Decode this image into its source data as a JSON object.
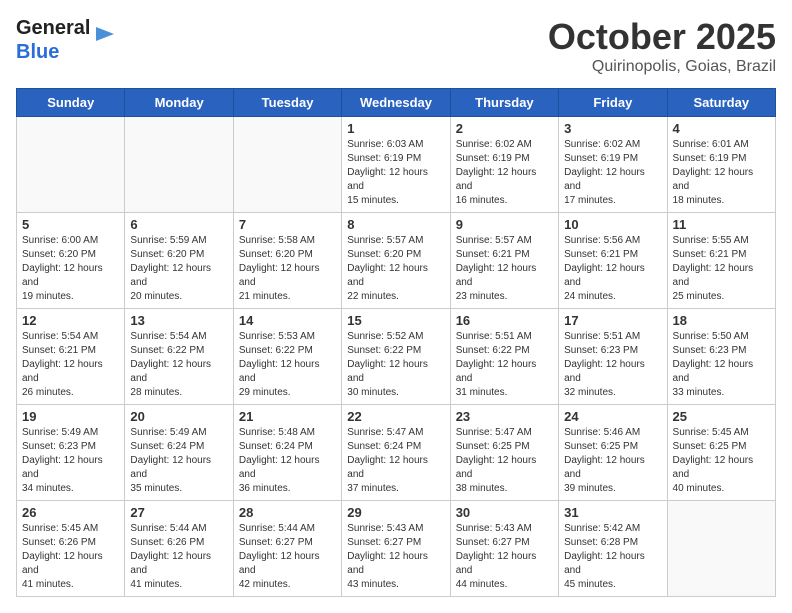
{
  "logo": {
    "line1": "General",
    "line2": "Blue"
  },
  "title": "October 2025",
  "subtitle": "Quirinopolis, Goias, Brazil",
  "weekdays": [
    "Sunday",
    "Monday",
    "Tuesday",
    "Wednesday",
    "Thursday",
    "Friday",
    "Saturday"
  ],
  "weeks": [
    [
      {
        "day": "",
        "info": ""
      },
      {
        "day": "",
        "info": ""
      },
      {
        "day": "",
        "info": ""
      },
      {
        "day": "1",
        "info": "Sunrise: 6:03 AM\nSunset: 6:19 PM\nDaylight: 12 hours and 15 minutes."
      },
      {
        "day": "2",
        "info": "Sunrise: 6:02 AM\nSunset: 6:19 PM\nDaylight: 12 hours and 16 minutes."
      },
      {
        "day": "3",
        "info": "Sunrise: 6:02 AM\nSunset: 6:19 PM\nDaylight: 12 hours and 17 minutes."
      },
      {
        "day": "4",
        "info": "Sunrise: 6:01 AM\nSunset: 6:19 PM\nDaylight: 12 hours and 18 minutes."
      }
    ],
    [
      {
        "day": "5",
        "info": "Sunrise: 6:00 AM\nSunset: 6:20 PM\nDaylight: 12 hours and 19 minutes."
      },
      {
        "day": "6",
        "info": "Sunrise: 5:59 AM\nSunset: 6:20 PM\nDaylight: 12 hours and 20 minutes."
      },
      {
        "day": "7",
        "info": "Sunrise: 5:58 AM\nSunset: 6:20 PM\nDaylight: 12 hours and 21 minutes."
      },
      {
        "day": "8",
        "info": "Sunrise: 5:57 AM\nSunset: 6:20 PM\nDaylight: 12 hours and 22 minutes."
      },
      {
        "day": "9",
        "info": "Sunrise: 5:57 AM\nSunset: 6:21 PM\nDaylight: 12 hours and 23 minutes."
      },
      {
        "day": "10",
        "info": "Sunrise: 5:56 AM\nSunset: 6:21 PM\nDaylight: 12 hours and 24 minutes."
      },
      {
        "day": "11",
        "info": "Sunrise: 5:55 AM\nSunset: 6:21 PM\nDaylight: 12 hours and 25 minutes."
      }
    ],
    [
      {
        "day": "12",
        "info": "Sunrise: 5:54 AM\nSunset: 6:21 PM\nDaylight: 12 hours and 26 minutes."
      },
      {
        "day": "13",
        "info": "Sunrise: 5:54 AM\nSunset: 6:22 PM\nDaylight: 12 hours and 28 minutes."
      },
      {
        "day": "14",
        "info": "Sunrise: 5:53 AM\nSunset: 6:22 PM\nDaylight: 12 hours and 29 minutes."
      },
      {
        "day": "15",
        "info": "Sunrise: 5:52 AM\nSunset: 6:22 PM\nDaylight: 12 hours and 30 minutes."
      },
      {
        "day": "16",
        "info": "Sunrise: 5:51 AM\nSunset: 6:22 PM\nDaylight: 12 hours and 31 minutes."
      },
      {
        "day": "17",
        "info": "Sunrise: 5:51 AM\nSunset: 6:23 PM\nDaylight: 12 hours and 32 minutes."
      },
      {
        "day": "18",
        "info": "Sunrise: 5:50 AM\nSunset: 6:23 PM\nDaylight: 12 hours and 33 minutes."
      }
    ],
    [
      {
        "day": "19",
        "info": "Sunrise: 5:49 AM\nSunset: 6:23 PM\nDaylight: 12 hours and 34 minutes."
      },
      {
        "day": "20",
        "info": "Sunrise: 5:49 AM\nSunset: 6:24 PM\nDaylight: 12 hours and 35 minutes."
      },
      {
        "day": "21",
        "info": "Sunrise: 5:48 AM\nSunset: 6:24 PM\nDaylight: 12 hours and 36 minutes."
      },
      {
        "day": "22",
        "info": "Sunrise: 5:47 AM\nSunset: 6:24 PM\nDaylight: 12 hours and 37 minutes."
      },
      {
        "day": "23",
        "info": "Sunrise: 5:47 AM\nSunset: 6:25 PM\nDaylight: 12 hours and 38 minutes."
      },
      {
        "day": "24",
        "info": "Sunrise: 5:46 AM\nSunset: 6:25 PM\nDaylight: 12 hours and 39 minutes."
      },
      {
        "day": "25",
        "info": "Sunrise: 5:45 AM\nSunset: 6:25 PM\nDaylight: 12 hours and 40 minutes."
      }
    ],
    [
      {
        "day": "26",
        "info": "Sunrise: 5:45 AM\nSunset: 6:26 PM\nDaylight: 12 hours and 41 minutes."
      },
      {
        "day": "27",
        "info": "Sunrise: 5:44 AM\nSunset: 6:26 PM\nDaylight: 12 hours and 41 minutes."
      },
      {
        "day": "28",
        "info": "Sunrise: 5:44 AM\nSunset: 6:27 PM\nDaylight: 12 hours and 42 minutes."
      },
      {
        "day": "29",
        "info": "Sunrise: 5:43 AM\nSunset: 6:27 PM\nDaylight: 12 hours and 43 minutes."
      },
      {
        "day": "30",
        "info": "Sunrise: 5:43 AM\nSunset: 6:27 PM\nDaylight: 12 hours and 44 minutes."
      },
      {
        "day": "31",
        "info": "Sunrise: 5:42 AM\nSunset: 6:28 PM\nDaylight: 12 hours and 45 minutes."
      },
      {
        "day": "",
        "info": ""
      }
    ]
  ]
}
